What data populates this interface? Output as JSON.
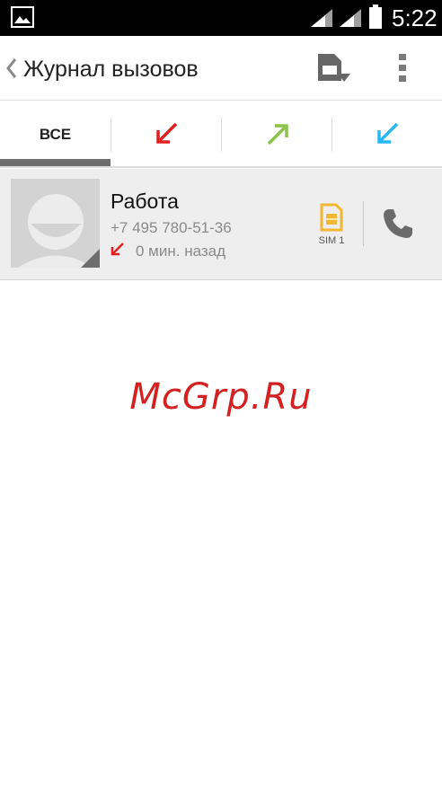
{
  "status_bar": {
    "time": "5:22",
    "icons": [
      "gallery-icon",
      "signal-icon",
      "signal-icon",
      "battery-icon"
    ]
  },
  "action_bar": {
    "title": "Журнал вызовов",
    "icons": [
      "back-chevron-icon",
      "save-sim-icon",
      "overflow-menu-icon"
    ]
  },
  "tabs": {
    "items": [
      {
        "label": "ВСЕ",
        "icon": null,
        "selected": true
      },
      {
        "label": "",
        "icon": "incoming-call-arrow-icon",
        "color": "#e02020"
      },
      {
        "label": "",
        "icon": "outgoing-call-arrow-icon",
        "color": "#8bc34a"
      },
      {
        "label": "",
        "icon": "missed-call-arrow-icon",
        "color": "#29b6f6"
      }
    ]
  },
  "call_log": [
    {
      "name": "Работа",
      "number": "+7 495 780-51-36",
      "type_icon": "incoming-call-arrow-icon",
      "type_color": "#e02020",
      "time_ago": "0 мин. назад",
      "sim_label": "SIM 1",
      "sim_color": "#f2b632"
    }
  ],
  "watermark": "McGrp.Ru"
}
